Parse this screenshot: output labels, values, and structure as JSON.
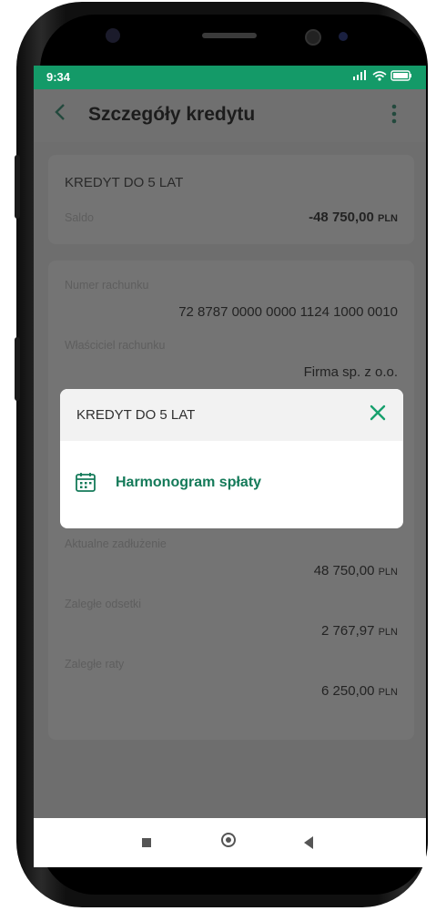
{
  "status_bar": {
    "time": "9:34",
    "icons": "📶 ◉ ▭"
  },
  "app_bar": {
    "back_glyph": "<",
    "title": "Szczegóły kredytu",
    "more_glyph": "⋮"
  },
  "summary_card": {
    "name": "KREDYT DO 5 LAT",
    "balance_label": "Saldo",
    "balance_amount": "-48 750,00",
    "balance_currency": "PLN"
  },
  "details_card": {
    "account_number_label": "Numer rachunku",
    "account_number": "72 8787 0000 0000 1124 1000 0010",
    "owner_label": "Właściciel rachunku",
    "owner_value": "Firma sp. z o.o.",
    "current_debt_label": "Aktualne zadłużenie",
    "current_debt_amount": "48 750,00",
    "current_debt_currency": "PLN",
    "overdue_interest_label": "Zaległe odsetki",
    "overdue_interest_amount": "2 767,97",
    "overdue_interest_currency": "PLN",
    "overdue_installments_label": "Zaległe raty",
    "overdue_installments_amount": "6 250,00",
    "overdue_installments_currency": "PLN"
  },
  "modal": {
    "title": "KREDYT DO 5 LAT",
    "close_icon": "close-icon",
    "item_label": "Harmonogram spłaty",
    "item_icon": "calendar-icon"
  },
  "nav_bar": {
    "recent_icon": "square-icon",
    "home_icon": "circle-icon",
    "back_icon": "triangle-icon"
  },
  "colors": {
    "accent": "#149a68",
    "link_green": "#147a59",
    "overlay": "#6e6e6e"
  }
}
